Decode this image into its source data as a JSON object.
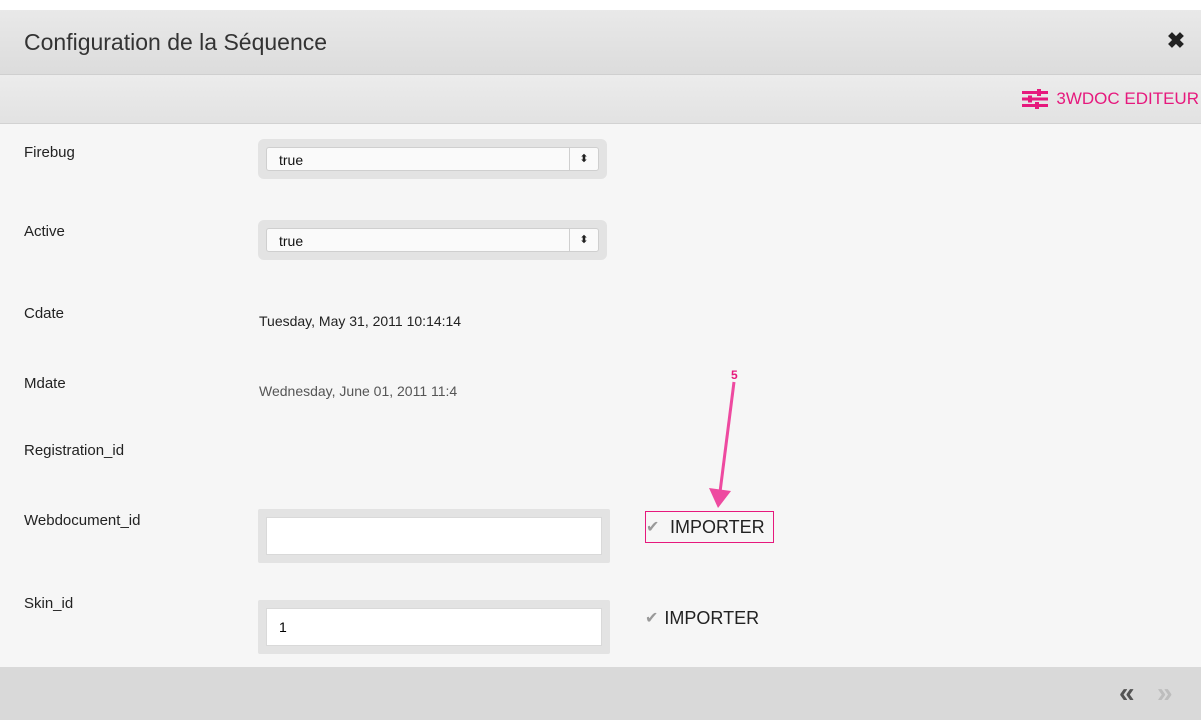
{
  "dialog": {
    "title": "Configuration de la Séquence",
    "close_symbol": "✖"
  },
  "toolbar": {
    "editor_label": "3WDOC EDITEUR",
    "editor_icon": "sliders-icon",
    "accent_color": "#e6197d"
  },
  "fields": {
    "firebug": {
      "label": "Firebug",
      "value": "true"
    },
    "active": {
      "label": "Active",
      "value": "true"
    },
    "cdate": {
      "label": "Cdate",
      "value": "Tuesday, May 31, 2011 10:14:14"
    },
    "mdate": {
      "label": "Mdate",
      "value": "Wednesday, June 01, 2011 11:4"
    },
    "registration_id": {
      "label": "Registration_id"
    },
    "webdocument_id": {
      "label": "Webdocument_id",
      "value": "",
      "button": "IMPORTER"
    },
    "skin_id": {
      "label": "Skin_id",
      "value": "1",
      "button": "IMPORTER"
    }
  },
  "select_arrows": "⬍",
  "check_symbol": "✔",
  "annotation": {
    "number": "5"
  },
  "footer": {
    "prev_symbol": "«",
    "next_symbol": "»"
  }
}
